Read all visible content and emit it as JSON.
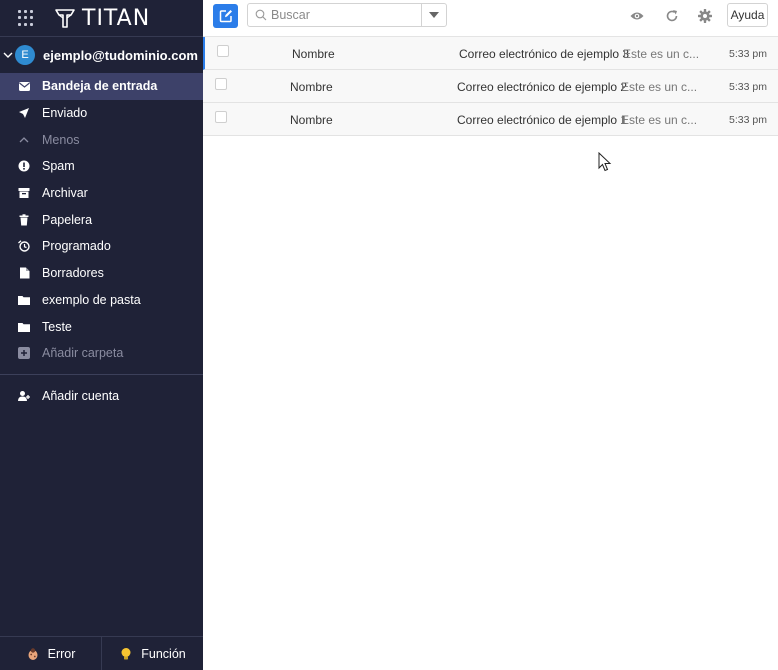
{
  "app": {
    "brand": "TITAN"
  },
  "account": {
    "initial": "E",
    "email": "ejemplo@tudominio.com"
  },
  "folders": [
    {
      "label": "Bandeja de entrada",
      "icon": "inbox-icon",
      "active": true
    },
    {
      "label": "Enviado",
      "icon": "send-icon"
    },
    {
      "label": "Menos",
      "icon": "chevron-up-icon",
      "muted": true
    },
    {
      "label": "Spam",
      "icon": "alert-icon"
    },
    {
      "label": "Archivar",
      "icon": "archive-icon"
    },
    {
      "label": "Papelera",
      "icon": "trash-icon"
    },
    {
      "label": "Programado",
      "icon": "scheduled-icon"
    },
    {
      "label": "Borradores",
      "icon": "draft-icon"
    },
    {
      "label": "exemplo de pasta",
      "icon": "folder-icon"
    },
    {
      "label": "Teste",
      "icon": "folder-icon"
    },
    {
      "label": "Añadir carpeta",
      "icon": "add-folder-icon",
      "muted": true
    }
  ],
  "add_account": "Añadir cuenta",
  "bottom": {
    "error_label": "Error",
    "feature_label": "Función"
  },
  "toolbar": {
    "search_placeholder": "Buscar",
    "help_label": "Ayuda"
  },
  "emails": [
    {
      "sender": "Nombre",
      "subject": "Correo electrónico de ejemplo 3",
      "preview": "Este es un c...",
      "time": "5:33 pm"
    },
    {
      "sender": "Nombre",
      "subject": "Correo electrónico de ejemplo 2",
      "preview": "Este es un c...",
      "time": "5:33 pm"
    },
    {
      "sender": "Nombre",
      "subject": "Correo electrónico de ejemplo 1",
      "preview": "Este es un c...",
      "time": "5:33 pm"
    }
  ],
  "colors": {
    "sidebar_bg": "#1f2237",
    "active_bg": "#3d4169",
    "accent": "#2b7de9"
  }
}
